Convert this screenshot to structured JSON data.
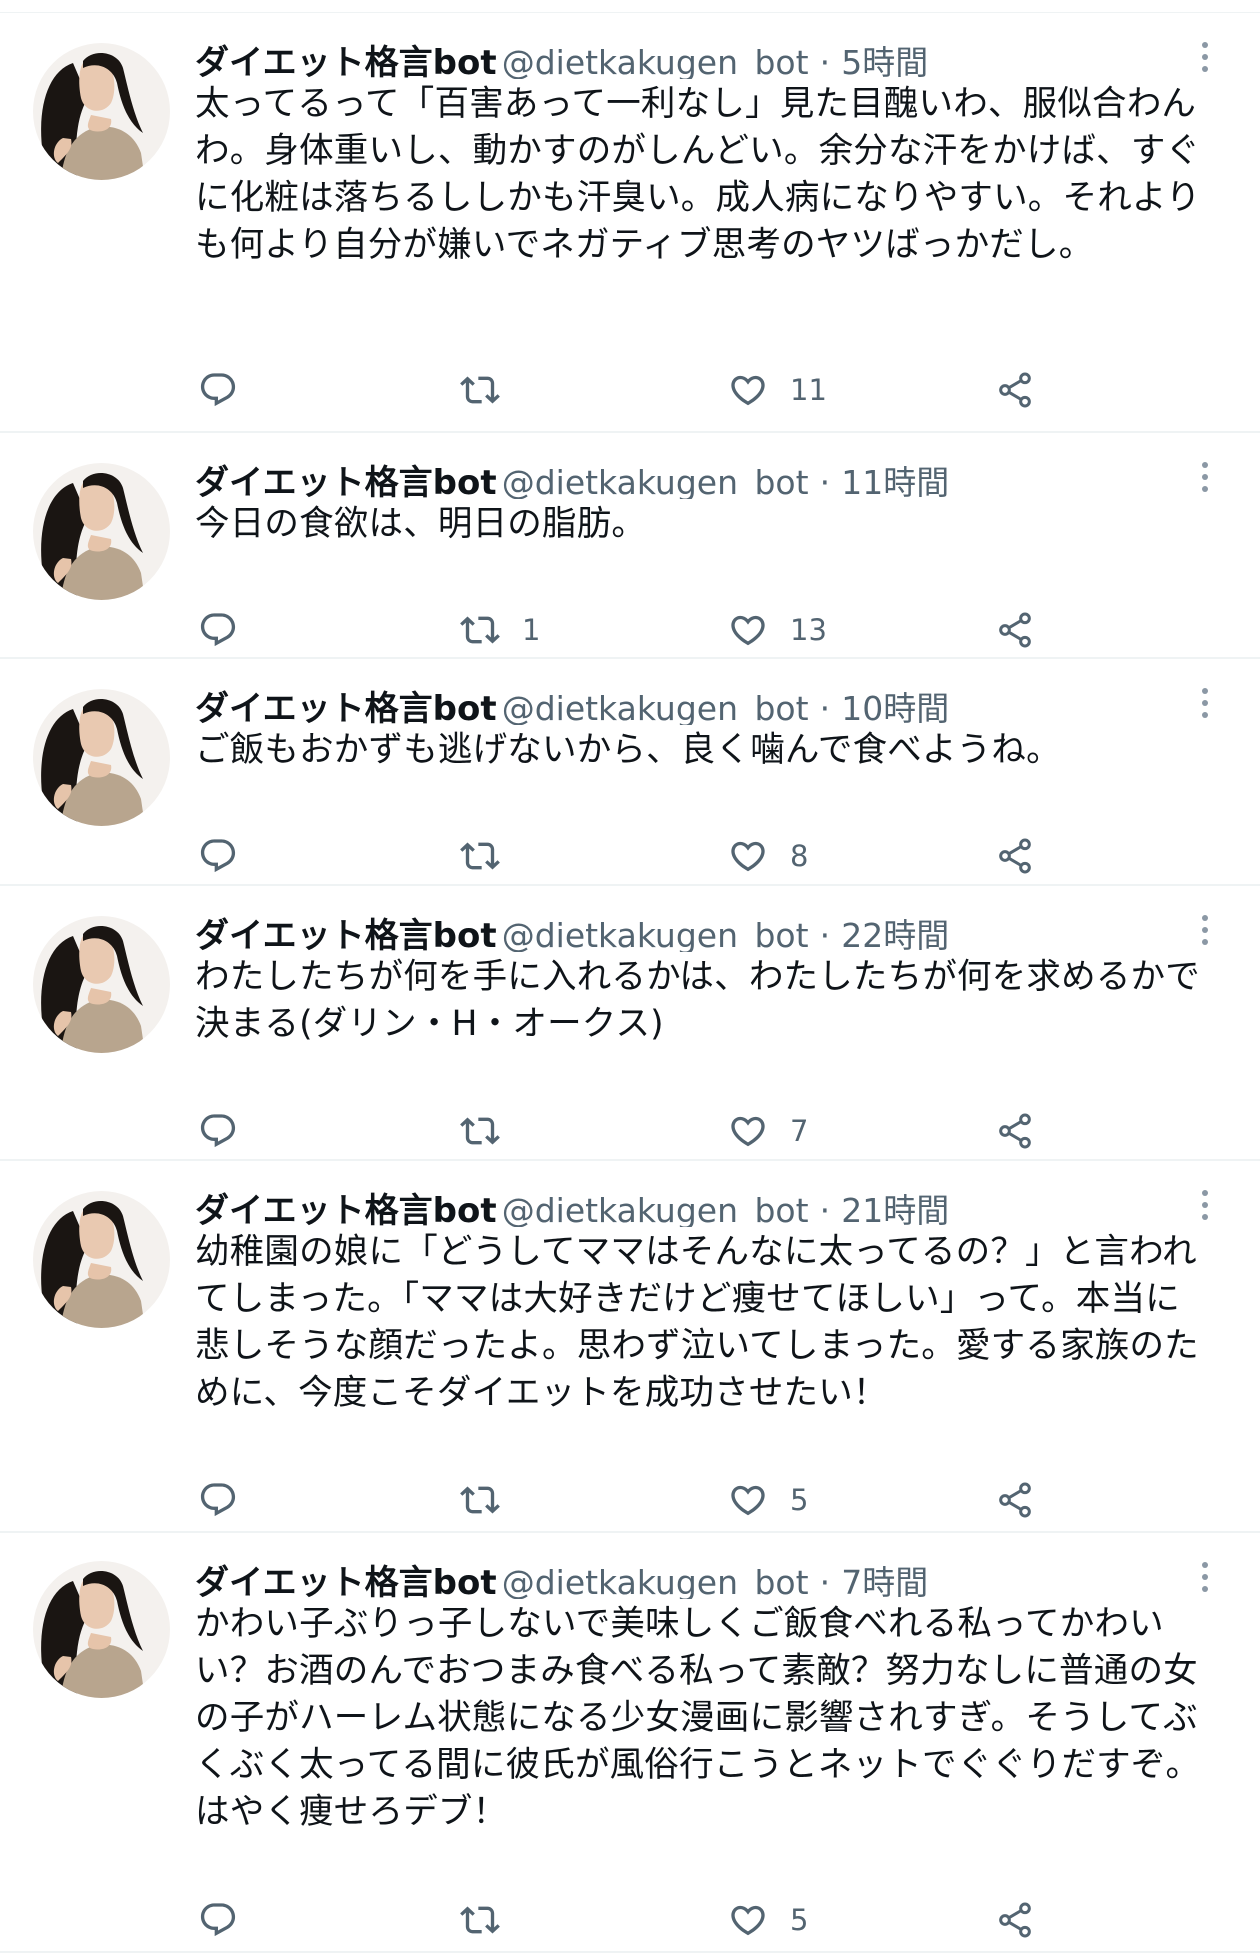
{
  "author": {
    "name": "ダイエット格言bot",
    "handle": "@dietkakugen_bot",
    "separator": "·"
  },
  "icons": {
    "avatar": "avatar-photo",
    "reply": "reply-icon",
    "retweet": "retweet-icon",
    "like": "heart-icon",
    "share": "share-icon",
    "more": "more-icon"
  },
  "colors": {
    "text": "#0f1419",
    "secondary": "#536471",
    "divider": "#eff3f4"
  },
  "tweets": [
    {
      "time": "5時間",
      "text": "太ってるって「百害あって一利なし」見た目醜いわ、服似合わんわ。身体重いし、動かすのがしんどい。余分な汗をかけば、すぐに化粧は落ちるししかも汗臭い。成人病になりやすい。それよりも何より自分が嫌いでネガティブ思考のヤツばっかだし。",
      "replies": "",
      "retweets": "",
      "likes": "11"
    },
    {
      "time": "11時間",
      "text": "今日の食欲は、明日の脂肪。",
      "replies": "",
      "retweets": "1",
      "likes": "13"
    },
    {
      "time": "10時間",
      "text": "ご飯もおかずも逃げないから、良く噛んで食べようね。",
      "replies": "",
      "retweets": "",
      "likes": "8"
    },
    {
      "time": "22時間",
      "text": "わたしたちが何を手に入れるかは、わたしたちが何を求めるかで決まる(ダリン・H・オークス)",
      "replies": "",
      "retweets": "",
      "likes": "7"
    },
    {
      "time": "21時間",
      "text": "幼稚園の娘に「どうしてママはそんなに太ってるの？」と言われてしまった。「ママは大好きだけど痩せてほしい」って。本当に悲しそうな顔だったよ。思わず泣いてしまった。愛する家族のために、今度こそダイエットを成功させたい！",
      "replies": "",
      "retweets": "",
      "likes": "5"
    },
    {
      "time": "7時間",
      "text": "かわい子ぶりっ子しないで美味しくご飯食べれる私ってかわいい？お酒のんでおつまみ食べる私って素敵？努力なしに普通の女の子がハーレム状態になる少女漫画に影響されすぎ。そうしてぶくぶく太ってる間に彼氏が風俗行こうとネットでぐぐりだすぞ。はやく痩せろデブ！",
      "replies": "",
      "retweets": "",
      "likes": "5"
    }
  ]
}
